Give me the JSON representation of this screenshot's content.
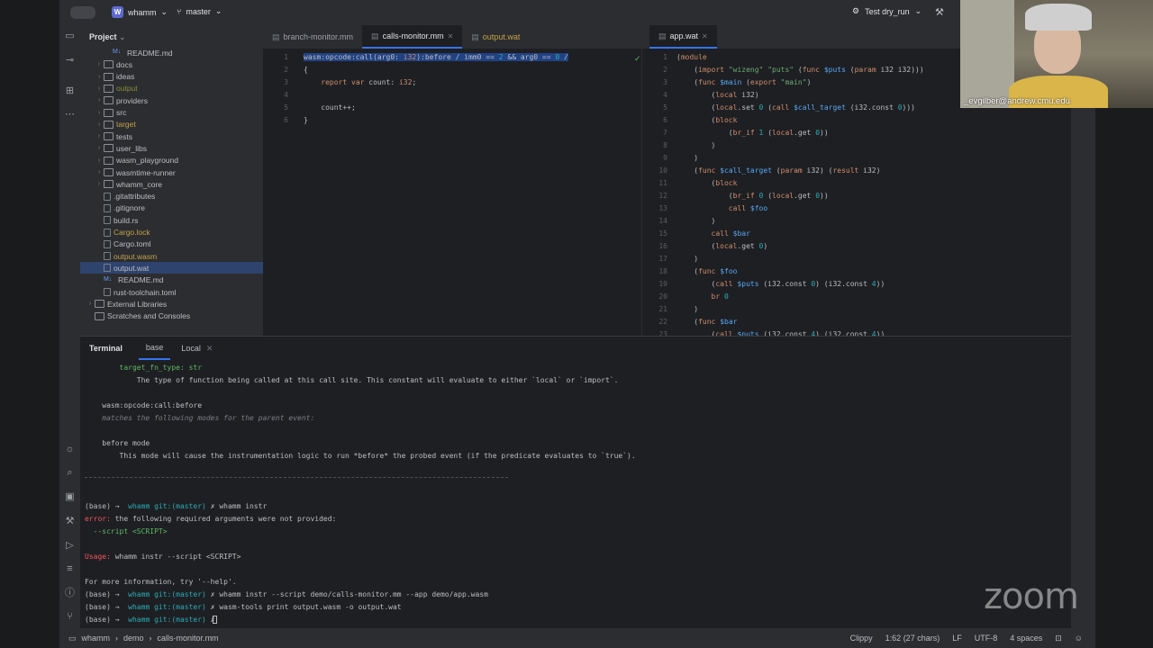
{
  "titlebar": {
    "project_badge": "W",
    "project": "whamm",
    "branch": "master",
    "run_config": "Test dry_run"
  },
  "project_panel": {
    "title": "Project",
    "items": [
      {
        "label": "README.md",
        "indent": 2,
        "kind": "md",
        "expand": false,
        "style": "normal"
      },
      {
        "label": "docs",
        "indent": 1,
        "kind": "folder",
        "expand": true,
        "style": "normal"
      },
      {
        "label": "ideas",
        "indent": 1,
        "kind": "folder",
        "expand": true,
        "style": "normal"
      },
      {
        "label": "output",
        "indent": 1,
        "kind": "folder",
        "expand": true,
        "style": "dim"
      },
      {
        "label": "providers",
        "indent": 1,
        "kind": "folder",
        "expand": true,
        "style": "normal"
      },
      {
        "label": "src",
        "indent": 1,
        "kind": "folder",
        "expand": true,
        "style": "normal"
      },
      {
        "label": "target",
        "indent": 1,
        "kind": "folder",
        "expand": true,
        "style": "yellow"
      },
      {
        "label": "tests",
        "indent": 1,
        "kind": "folder",
        "expand": true,
        "style": "normal"
      },
      {
        "label": "user_libs",
        "indent": 1,
        "kind": "folder",
        "expand": true,
        "style": "normal"
      },
      {
        "label": "wasm_playground",
        "indent": 1,
        "kind": "folder",
        "expand": true,
        "style": "normal"
      },
      {
        "label": "wasmtime-runner",
        "indent": 1,
        "kind": "folder",
        "expand": true,
        "style": "normal"
      },
      {
        "label": "whamm_core",
        "indent": 1,
        "kind": "folder",
        "expand": true,
        "style": "normal"
      },
      {
        "label": ".gitattributes",
        "indent": 1,
        "kind": "file",
        "expand": false,
        "style": "normal"
      },
      {
        "label": ".gitignore",
        "indent": 1,
        "kind": "file",
        "expand": false,
        "style": "normal"
      },
      {
        "label": "build.rs",
        "indent": 1,
        "kind": "file",
        "expand": false,
        "style": "normal"
      },
      {
        "label": "Cargo.lock",
        "indent": 1,
        "kind": "file",
        "expand": false,
        "style": "yellow"
      },
      {
        "label": "Cargo.toml",
        "indent": 1,
        "kind": "file",
        "expand": false,
        "style": "normal"
      },
      {
        "label": "output.wasm",
        "indent": 1,
        "kind": "file",
        "expand": false,
        "style": "yellow"
      },
      {
        "label": "output.wat",
        "indent": 1,
        "kind": "file",
        "expand": false,
        "style": "selected"
      },
      {
        "label": "README.md",
        "indent": 1,
        "kind": "md",
        "expand": false,
        "style": "normal"
      },
      {
        "label": "rust-toolchain.toml",
        "indent": 1,
        "kind": "file",
        "expand": false,
        "style": "normal"
      },
      {
        "label": "External Libraries",
        "indent": 0,
        "kind": "lib",
        "expand": true,
        "style": "normal"
      },
      {
        "label": "Scratches and Consoles",
        "indent": 0,
        "kind": "lib",
        "expand": false,
        "style": "normal"
      }
    ]
  },
  "editor_left": {
    "tabs": [
      {
        "label": "branch-monitor.mm",
        "active": false,
        "style": "normal"
      },
      {
        "label": "calls-monitor.mm",
        "active": true,
        "style": "normal"
      },
      {
        "label": "output.wat",
        "active": false,
        "style": "warn"
      }
    ],
    "lines": [
      {
        "n": "1",
        "text": "wasm:opcode:call(arg0: i32):before / imm0 == 2 && arg0 == 0 /"
      },
      {
        "n": "2",
        "text": "{"
      },
      {
        "n": "3",
        "text": "    report var count: i32;"
      },
      {
        "n": "4",
        "text": ""
      },
      {
        "n": "5",
        "text": "    count++;"
      },
      {
        "n": "6",
        "text": "}"
      }
    ]
  },
  "editor_right": {
    "tabs": [
      {
        "label": "app.wat",
        "active": true,
        "style": "normal"
      }
    ],
    "lines": [
      {
        "n": "1",
        "text": "(module"
      },
      {
        "n": "2",
        "text": "    (import \"wizeng\" \"puts\" (func $puts (param i32 i32)))"
      },
      {
        "n": "3",
        "text": "    (func $main (export \"main\")"
      },
      {
        "n": "4",
        "text": "        (local i32)"
      },
      {
        "n": "5",
        "text": "        (local.set 0 (call $call_target (i32.const 0)))"
      },
      {
        "n": "6",
        "text": "        (block"
      },
      {
        "n": "7",
        "text": "            (br_if 1 (local.get 0))"
      },
      {
        "n": "8",
        "text": "        )"
      },
      {
        "n": "9",
        "text": "    )"
      },
      {
        "n": "10",
        "text": "    (func $call_target (param i32) (result i32)"
      },
      {
        "n": "11",
        "text": "        (block"
      },
      {
        "n": "12",
        "text": "            (br_if 0 (local.get 0))"
      },
      {
        "n": "13",
        "text": "            call $foo"
      },
      {
        "n": "14",
        "text": "        )"
      },
      {
        "n": "15",
        "text": "        call $bar"
      },
      {
        "n": "16",
        "text": "        (local.get 0)"
      },
      {
        "n": "17",
        "text": "    )"
      },
      {
        "n": "18",
        "text": "    (func $foo"
      },
      {
        "n": "19",
        "text": "        (call $puts (i32.const 0) (i32.const 4))"
      },
      {
        "n": "20",
        "text": "        br 0"
      },
      {
        "n": "21",
        "text": "    )"
      },
      {
        "n": "22",
        "text": "    (func $bar"
      },
      {
        "n": "23",
        "text": "        (call $puts (i32.const 4) (i32.const 4))"
      }
    ]
  },
  "terminal": {
    "title": "Terminal",
    "tabs": [
      "base",
      "Local"
    ],
    "lines": [
      {
        "cls": "grn",
        "text": "        target_fn_type: str"
      },
      {
        "cls": "",
        "text": "            The type of function being called at this call site. This constant will evaluate to either `local` or `import`."
      },
      {
        "cls": "",
        "text": ""
      },
      {
        "cls": "",
        "text": "    wasm:opcode:call:before"
      },
      {
        "cls": "dim",
        "text": "    matches the following modes for the parent event:"
      },
      {
        "cls": "",
        "text": ""
      },
      {
        "cls": "",
        "text": "    before mode"
      },
      {
        "cls": "",
        "text": "        This mode will cause the instrumentation logic to run *before* the probed event (if the predicate evaluates to `true`)."
      },
      {
        "cls": "",
        "text": ""
      },
      {
        "cls": "sep",
        "text": ""
      },
      {
        "cls": "",
        "text": ""
      },
      {
        "cls": "",
        "text": "(base) →  whamm git:(master) ✗ whamm instr"
      },
      {
        "cls": "",
        "text": "error: the following required arguments were not provided:"
      },
      {
        "cls": "grn",
        "text": "  --script <SCRIPT>"
      },
      {
        "cls": "",
        "text": ""
      },
      {
        "cls": "",
        "text": "Usage: whamm instr --script <SCRIPT>"
      },
      {
        "cls": "",
        "text": ""
      },
      {
        "cls": "",
        "text": "For more information, try '--help'."
      },
      {
        "cls": "",
        "text": "(base) →  whamm git:(master) ✗ whamm instr --script demo/calls-monitor.mm --app demo/app.wasm"
      },
      {
        "cls": "",
        "text": "(base) →  whamm git:(master) ✗ wasm-tools print output.wasm -o output.wat"
      },
      {
        "cls": "",
        "text": "(base) →  whamm git:(master) ✗ "
      }
    ]
  },
  "statusbar": {
    "breadcrumb": [
      "whamm",
      "demo",
      "calls-monitor.mm"
    ],
    "clippy": "Clippy",
    "position": "1:62 (27 chars)",
    "line_sep": "LF",
    "encoding": "UTF-8",
    "indent": "4 spaces"
  },
  "webcam": {
    "label": "_evgilber@andrew.cmu.edu"
  },
  "watermark": "zoom"
}
